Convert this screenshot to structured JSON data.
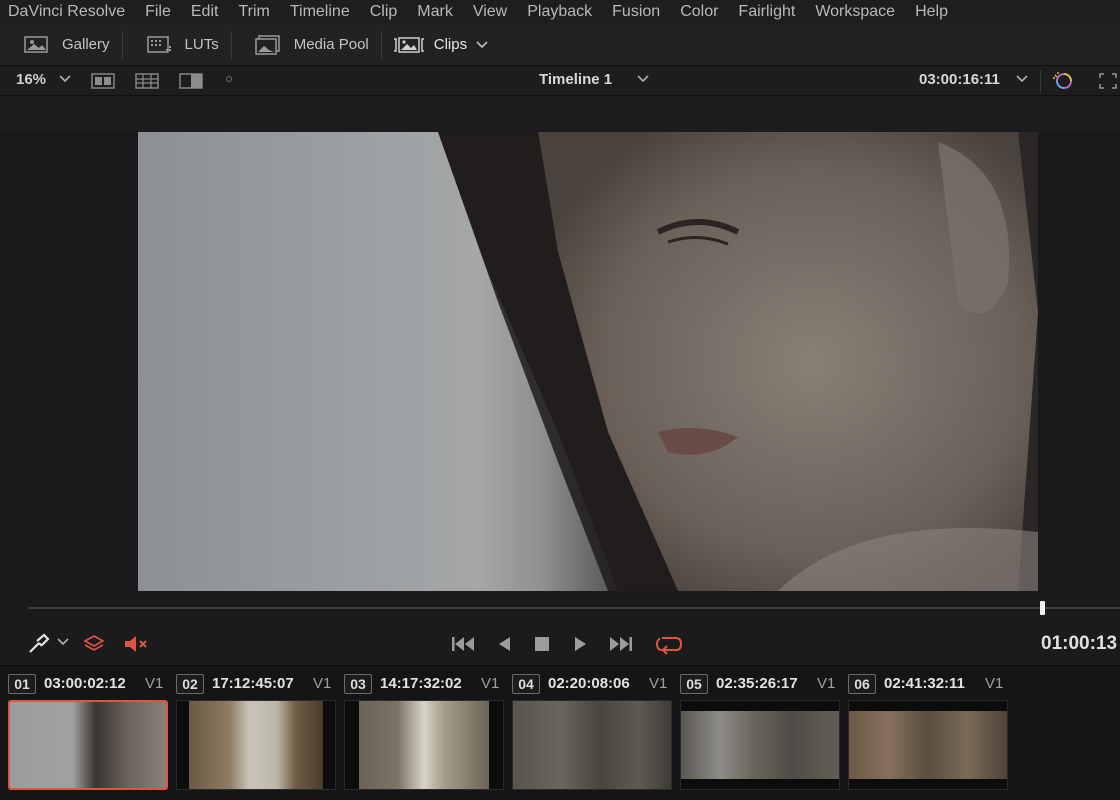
{
  "menu": {
    "items": [
      "DaVinci Resolve",
      "File",
      "Edit",
      "Trim",
      "Timeline",
      "Clip",
      "Mark",
      "View",
      "Playback",
      "Fusion",
      "Color",
      "Fairlight",
      "Workspace",
      "Help"
    ]
  },
  "toolbar": {
    "gallery": "Gallery",
    "luts": "LUTs",
    "media_pool": "Media Pool",
    "clips": "Clips"
  },
  "viewer_header": {
    "zoom": "16%",
    "timeline_name": "Timeline 1",
    "timecode": "03:00:16:11"
  },
  "transport": {
    "timecode": "01:00:13"
  },
  "colors": {
    "accent_red": "#e0553f",
    "background": "#1b1b1d"
  },
  "clips": [
    {
      "num": "01",
      "timecode": "03:00:02:12",
      "track": "V1",
      "selected": true
    },
    {
      "num": "02",
      "timecode": "17:12:45:07",
      "track": "V1",
      "selected": false
    },
    {
      "num": "03",
      "timecode": "14:17:32:02",
      "track": "V1",
      "selected": false
    },
    {
      "num": "04",
      "timecode": "02:20:08:06",
      "track": "V1",
      "selected": false
    },
    {
      "num": "05",
      "timecode": "02:35:26:17",
      "track": "V1",
      "selected": false
    },
    {
      "num": "06",
      "timecode": "02:41:32:11",
      "track": "V1",
      "selected": false
    }
  ]
}
